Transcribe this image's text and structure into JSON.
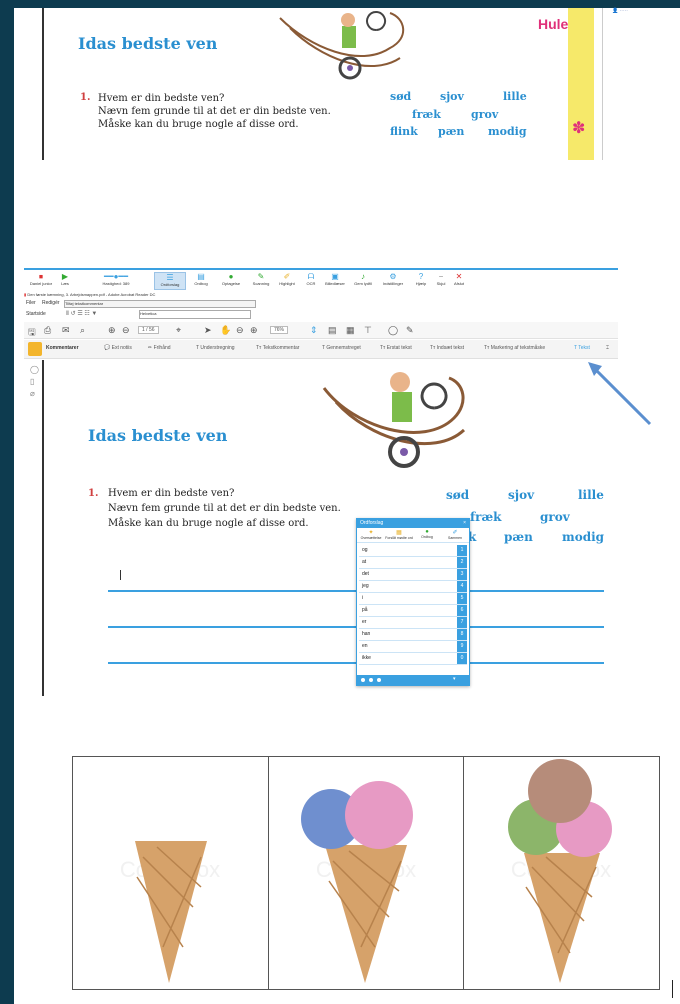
{
  "panel1": {
    "title": "Idas bedste ven",
    "question_number": "1.",
    "question_lines": [
      "Hvem er din bedste ven?",
      "Nævn fem grunde til at det er din bedste ven.",
      "Måske kan du bruge nogle af disse ord."
    ],
    "words": [
      "sød",
      "sjov",
      "lille",
      "fræk",
      "grov",
      "flink",
      "pæn",
      "modig"
    ],
    "corner_label": "Hulen"
  },
  "app": {
    "ribbon": [
      {
        "label": "Daniel junior",
        "icon": "stop-icon"
      },
      {
        "label": "Læs",
        "icon": "play-icon"
      },
      {
        "label": "Hastighed: 389",
        "icon": "speed-slider-icon"
      },
      {
        "label": "Ordforslag",
        "icon": "wordlist-icon",
        "selected": true
      },
      {
        "label": "Ordbog",
        "icon": "book-icon"
      },
      {
        "label": "Optagelse",
        "icon": "record-icon"
      },
      {
        "label": "Scanning",
        "icon": "scan-icon"
      },
      {
        "label": "Highlight",
        "icon": "highlight-icon"
      },
      {
        "label": "OCR",
        "icon": "ocr-icon"
      },
      {
        "label": "Billedlæser",
        "icon": "image-reader-icon"
      },
      {
        "label": "Gem lydfil",
        "icon": "save-audio-icon"
      },
      {
        "label": "Indstillinger",
        "icon": "settings-icon"
      },
      {
        "label": "Hjælp",
        "icon": "help-icon"
      },
      {
        "label": "Skjul",
        "icon": "hide-icon"
      },
      {
        "label": "Afslut",
        "icon": "close-icon"
      }
    ],
    "window_title": "Den første kæmning, 3. Arbejdsmappen.pdf - Adobe Acrobat Reader DC",
    "menu": [
      "Filer",
      "Redigér",
      "Tilføj tekstkommentar"
    ],
    "font_row": {
      "label": "Startside",
      "font": "Helvetica"
    },
    "page_counter": "1 / 56",
    "zoom": "76%",
    "comment_tools": [
      "Kommentarer",
      "Ext notiis",
      "Frihånd",
      "Understregning",
      "Tekstkommentar",
      "Gennemstreget",
      "Erstat tekst",
      "Indsæt tekst",
      "Markering af tekstmåske",
      "Tekst"
    ],
    "page_title": "Idas bedste ven",
    "question_number": "1.",
    "question_lines": [
      "Hvem er din bedste ven?",
      "Nævn fem grunde til at det er din bedste ven.",
      "Måske kan du bruge nogle af disse ord."
    ],
    "words_row1": [
      "sød",
      "sjov",
      "lille"
    ],
    "words_row2": [
      "fræk",
      "grov"
    ],
    "words_row3": [
      "k",
      "pæn",
      "modig"
    ],
    "ordbog": {
      "title": "Ordforslag",
      "tabs": [
        "Oversættelse",
        "Forslåt mødte ord",
        "Ordbog",
        "Sammen"
      ],
      "rows": [
        {
          "word": "og",
          "n": "1"
        },
        {
          "word": "at",
          "n": "2"
        },
        {
          "word": "det",
          "n": "3"
        },
        {
          "word": "jeg",
          "n": "4"
        },
        {
          "word": "i",
          "n": "5"
        },
        {
          "word": "på",
          "n": "6"
        },
        {
          "word": "er",
          "n": "7"
        },
        {
          "word": "han",
          "n": "8"
        },
        {
          "word": "en",
          "n": "9"
        },
        {
          "word": "ikke",
          "n": "0"
        }
      ]
    }
  },
  "icecream": {
    "watermark": "Colourbox",
    "cells": [
      {
        "scoops": []
      },
      {
        "scoops": [
          "blue",
          "pink"
        ]
      },
      {
        "scoops": [
          "green",
          "pink",
          "brown"
        ]
      }
    ]
  }
}
